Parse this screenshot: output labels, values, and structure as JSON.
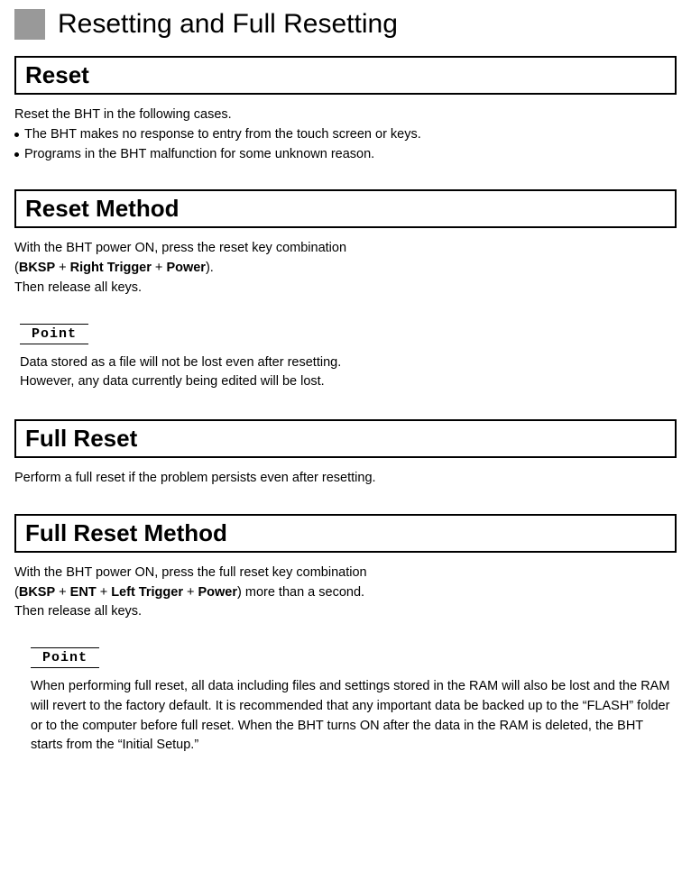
{
  "title": "Resetting and Full Resetting",
  "sections": {
    "reset": {
      "heading": "Reset",
      "intro": "Reset the BHT in the following cases.",
      "bullet1": "The BHT makes no response to entry from the touch screen or keys.",
      "bullet2": "Programs in the BHT malfunction for some unknown reason."
    },
    "resetMethod": {
      "heading": "Reset Method",
      "line1": "With the BHT power ON, press the reset key combination",
      "combo_open": "(",
      "k1": "BKSP",
      "plus": " + ",
      "k2": "Right Trigger",
      "k3": "Power",
      "combo_close": ").",
      "line3": "Then release all keys."
    },
    "point1": {
      "label": "Point",
      "line1": "Data stored as a file will not be lost even after resetting.",
      "line2": "However, any data currently being edited will be lost."
    },
    "fullReset": {
      "heading": "Full Reset",
      "line1": "Perform a full reset if the problem persists even after resetting."
    },
    "fullResetMethod": {
      "heading": "Full Reset Method",
      "line1": "With the BHT power ON, press the full reset key combination",
      "combo_open": "(",
      "k1": "BKSP",
      "plus": " + ",
      "k2": "ENT",
      "k3": "Left Trigger",
      "k4": "Power",
      "combo_close": ") more than a second.",
      "line3": "Then release all keys."
    },
    "point2": {
      "label": "Point",
      "text": "When performing full reset, all data including files and settings stored in the RAM will also be lost and the RAM will revert to the factory default. It is recommended that any important data be backed up to the “FLASH” folder or to the computer before full reset. When the BHT turns ON after the data in the RAM is deleted, the BHT starts from the “Initial Setup.”"
    }
  }
}
